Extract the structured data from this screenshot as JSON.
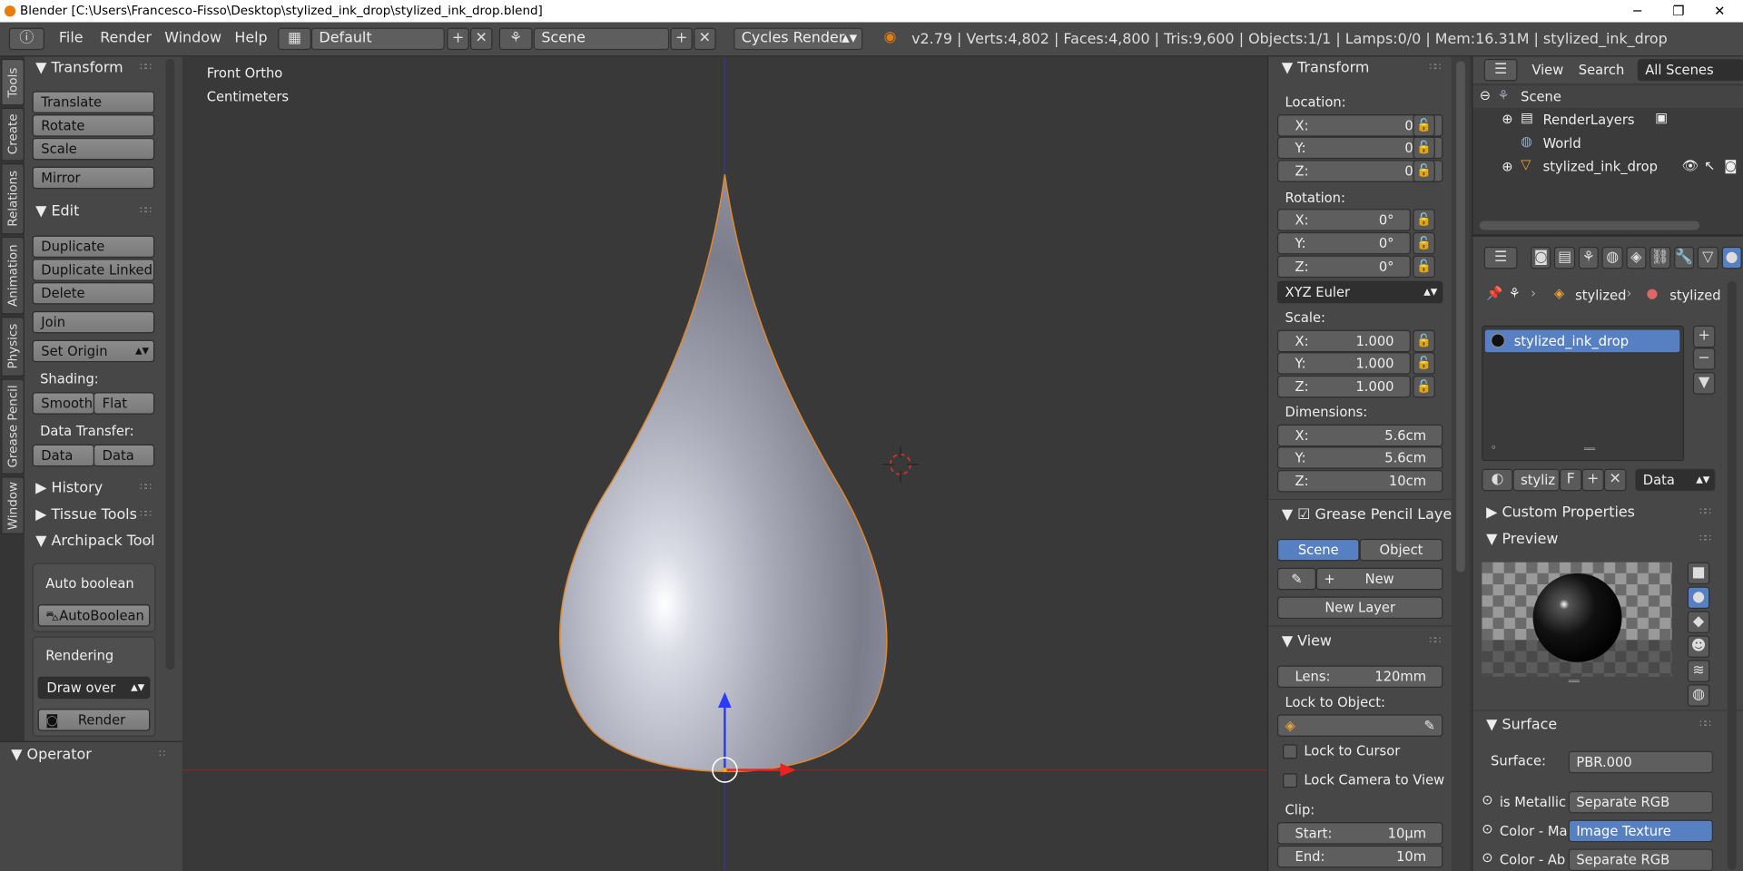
{
  "window": {
    "title": "Blender [C:\\Users\\Francesco-Fisso\\Desktop\\stylized_ink_drop\\stylized_ink_drop.blend]",
    "min": "─",
    "max": "❐",
    "close": "✕"
  },
  "header": {
    "menus": [
      "File",
      "Render",
      "Window",
      "Help"
    ],
    "layout": "Default",
    "scene": "Scene",
    "engine": "Cycles Render",
    "stats": "v2.79 | Verts:4,802 | Faces:4,800 | Tris:9,600 | Objects:1/1 | Lamps:0/0 | Mem:16.31M | stylized_ink_drop"
  },
  "tabs": [
    "Tools",
    "Create",
    "Relations",
    "Animation",
    "Physics",
    "Grease Pencil",
    "Window"
  ],
  "tools": {
    "transform_title": "Transform",
    "translate": "Translate",
    "rotate": "Rotate",
    "scale": "Scale",
    "mirror": "Mirror",
    "edit_title": "Edit",
    "duplicate": "Duplicate",
    "duplicate_linked": "Duplicate Linked",
    "delete": "Delete",
    "join": "Join",
    "set_origin": "Set Origin",
    "shading_label": "Shading:",
    "smooth": "Smooth",
    "flat": "Flat",
    "data_transfer_label": "Data Transfer:",
    "data": "Data",
    "data_la": "Data La",
    "history": "History",
    "tissue": "Tissue Tools",
    "archipack": "Archipack Tools",
    "auto_boolean_label": "Auto boolean",
    "auto_boolean": "AutoBoolean",
    "rendering_label": "Rendering",
    "draw_over": "Draw over",
    "render": "Render",
    "operator": "Operator"
  },
  "viewport": {
    "view_name": "Front Ortho",
    "units": "Centimeters"
  },
  "npanel": {
    "transform_title": "Transform",
    "location_label": "Location:",
    "location": [
      {
        "k": "X:",
        "v": "0m"
      },
      {
        "k": "Y:",
        "v": "0m"
      },
      {
        "k": "Z:",
        "v": "0m"
      }
    ],
    "rotation_label": "Rotation:",
    "rotation": [
      {
        "k": "X:",
        "v": "0°"
      },
      {
        "k": "Y:",
        "v": "0°"
      },
      {
        "k": "Z:",
        "v": "0°"
      }
    ],
    "rotation_mode": "XYZ Euler",
    "scale_label": "Scale:",
    "scale": [
      {
        "k": "X:",
        "v": "1.000"
      },
      {
        "k": "Y:",
        "v": "1.000"
      },
      {
        "k": "Z:",
        "v": "1.000"
      }
    ],
    "dimensions_label": "Dimensions:",
    "dimensions": [
      {
        "k": "X:",
        "v": "5.6cm"
      },
      {
        "k": "Y:",
        "v": "5.6cm"
      },
      {
        "k": "Z:",
        "v": "10cm"
      }
    ],
    "grease_title": "Grease Pencil Layer",
    "gp_scene": "Scene",
    "gp_object": "Object",
    "gp_new": "New",
    "gp_new_layer": "New Layer",
    "view_title": "View",
    "lens_label": "Lens:",
    "lens_value": "120mm",
    "lock_object_label": "Lock to Object:",
    "lock_cursor": "Lock to Cursor",
    "lock_camera": "Lock Camera to View",
    "clip_label": "Clip:",
    "clip_start_label": "Start:",
    "clip_start": "10µm",
    "clip_end_label": "End:",
    "clip_end": "10m"
  },
  "outliner": {
    "view": "View",
    "search": "Search",
    "filter": "All Scenes",
    "items": [
      "Scene",
      "RenderLayers",
      "World",
      "stylized_ink_drop"
    ]
  },
  "properties": {
    "crumb1": "stylized",
    "crumb2": "stylized",
    "material_slot": "stylized_ink_drop",
    "mat_name": "styliz",
    "fake_user": "F",
    "link": "Data",
    "custom_props": "Custom Properties",
    "preview": "Preview",
    "surface_title": "Surface",
    "surface_label": "Surface:",
    "surface_value": "PBR.000",
    "inputs": [
      {
        "k": "is Metallic",
        "v": "Separate RGB"
      },
      {
        "k": "Color - Ma",
        "v": "Image Texture"
      },
      {
        "k": "Color - Ab",
        "v": "Separate RGB"
      }
    ]
  }
}
